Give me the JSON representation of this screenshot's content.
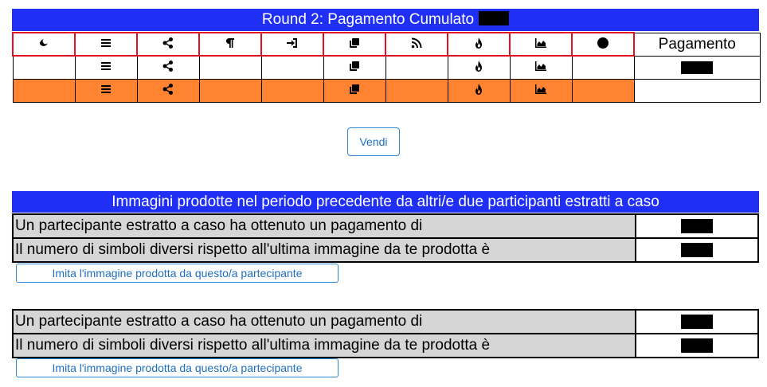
{
  "round": {
    "title": "Round 2: Pagamento Cumulato",
    "payment_label": "Pagamento",
    "rows": [
      [
        "moon-icon",
        "list-icon",
        "share-icon",
        "paragraph-icon",
        "sign-in-icon",
        "clone-icon",
        "rss-icon",
        "fire-icon",
        "chart-area-icon",
        "circle-icon"
      ],
      [
        "",
        "list-icon",
        "share-icon",
        "",
        "",
        "clone-icon",
        "",
        "fire-icon",
        "chart-area-icon",
        ""
      ],
      [
        "",
        "list-icon",
        "share-icon",
        "",
        "",
        "clone-icon",
        "",
        "fire-icon",
        "chart-area-icon",
        ""
      ]
    ],
    "highlight_color": "#ff8330"
  },
  "sell_button": "Vendi",
  "images_section": {
    "title": "Immagini prodotte nel periodo precedente da altri/e due participanti estratti a caso",
    "participants": [
      {
        "payment_label": "Un partecipante estratto a caso ha ottenuto un pagamento di",
        "diff_label": "Il numero di simboli diversi rispetto all'ultima immagine da te prodotta è",
        "imitate_button": "Imita l'immagine prodotta da questo/a partecipante"
      },
      {
        "payment_label": "Un partecipante estratto a caso ha ottenuto un pagamento di",
        "diff_label": "Il numero di simboli diversi rispetto all'ultima immagine da te prodotta è",
        "imitate_button": "Imita l'immagine prodotta da questo/a partecipante"
      }
    ]
  },
  "colors": {
    "header_blue": "#1f2ff5",
    "border_red": "#e01020",
    "button_blue": "#1f6fc0"
  }
}
